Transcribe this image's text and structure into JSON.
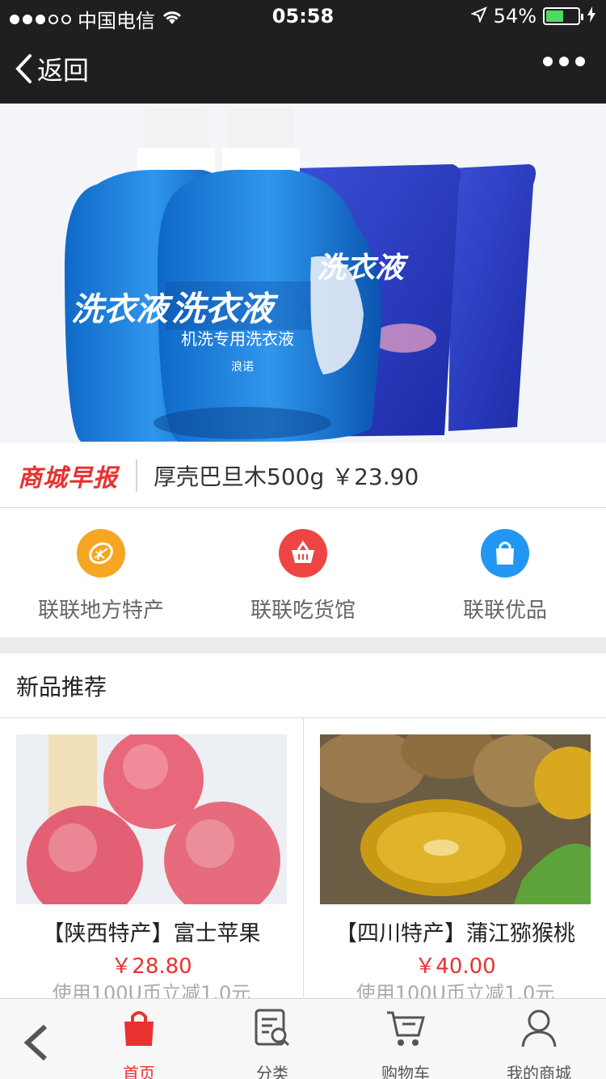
{
  "status_bar": {
    "carrier": "中国电信",
    "time": "05:58",
    "battery": "54%",
    "battery_level": 0.54
  },
  "nav": {
    "back_label": "返回"
  },
  "ticker": {
    "logo": "商城早报",
    "news": "厚壳巴旦木500g ￥23.90"
  },
  "banner": {
    "product_label": "洗衣液",
    "subtitle": "机洗专用洗衣液",
    "brand": "浪诺"
  },
  "categories": [
    {
      "label": "联联地方特产",
      "icon": "lemon-icon",
      "color": "#f5a623"
    },
    {
      "label": "联联吃货馆",
      "icon": "basket-icon",
      "color": "#ef4444"
    },
    {
      "label": "联联优品",
      "icon": "shopping-bag-icon",
      "color": "#2196f3"
    }
  ],
  "section": {
    "title": "新品推荐"
  },
  "products": [
    {
      "name": "【陕西特产】富士苹果",
      "price": "￥28.80",
      "promo": "使用100U币立减1.0元"
    },
    {
      "name": "【四川特产】蒲江猕猴桃",
      "price": "￥40.00",
      "promo": "使用100U币立减1.0元"
    }
  ],
  "tabbar": {
    "items": [
      {
        "label": "首页",
        "icon": "home-bag-icon",
        "active": true
      },
      {
        "label": "分类",
        "icon": "category-search-icon",
        "active": false
      },
      {
        "label": "购物车",
        "icon": "cart-icon",
        "active": false
      },
      {
        "label": "我的商城",
        "icon": "user-icon",
        "active": false
      }
    ]
  },
  "colors": {
    "accent": "#e8322f",
    "nav_bg": "#1f1f22"
  }
}
